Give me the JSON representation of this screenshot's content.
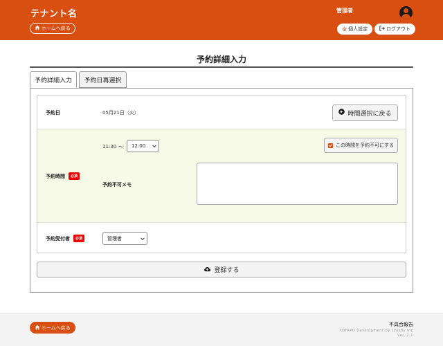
{
  "header": {
    "tenant_name": "テナント名",
    "home_label": "ホームへ戻る",
    "user_name": "管理者",
    "settings_label": "個人設定",
    "logout_label": "ログアウト"
  },
  "page": {
    "title": "予約詳細入力"
  },
  "tabs": [
    {
      "label": "予約詳細入力",
      "active": true
    },
    {
      "label": "予約日再選択",
      "active": false
    }
  ],
  "form": {
    "date": {
      "label": "予約日",
      "value": "05月21日（火）",
      "back_button": "時間選択に戻る"
    },
    "time": {
      "label": "予約時間",
      "required": "必須",
      "start": "11:30",
      "separator": "〜",
      "end_selected": "12:00",
      "unavailable_label": "この時間を予約不可にする",
      "unavailable_checked": true,
      "memo_label": "予約不可メモ",
      "memo_value": ""
    },
    "staff": {
      "label": "予約受付者",
      "required": "必須",
      "selected": "管理者"
    }
  },
  "submit_label": "登録する",
  "footer": {
    "home_label": "ホームへ戻る",
    "report_label": "不具合報告",
    "copyright_1": "TOYAPO Development by syoshy inc",
    "copyright_2": "Ver. 2.1"
  },
  "colors": {
    "brand": "#d94f12",
    "highlight_row": "#f6fae7",
    "required": "#ee0000"
  }
}
